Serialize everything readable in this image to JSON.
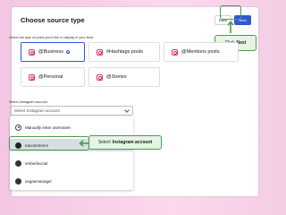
{
  "modal": {
    "title": "Choose source type",
    "back_label": "Back",
    "next_label": "Next",
    "subtitle": "Select the type of posts you'd like to display in your feed"
  },
  "source_types": [
    {
      "label": "@Business",
      "selected": true
    },
    {
      "label": "#Hashtags posts",
      "selected": false
    },
    {
      "label": "@Mentions posts",
      "selected": false
    },
    {
      "label": "@Personal",
      "selected": false
    },
    {
      "label": "@Stories",
      "selected": false
    }
  ],
  "account": {
    "label": "Select Instagram account",
    "placeholder": "Select Instagram account",
    "options": [
      {
        "label": "Manually enter username",
        "icon": "user-icon",
        "active": false
      },
      {
        "label": "eacommerce",
        "icon": "avatar",
        "active": true
      },
      {
        "label": "embedsocial",
        "icon": "avatar",
        "active": false
      },
      {
        "label": "veganmanager",
        "icon": "avatar",
        "active": false
      }
    ]
  },
  "callouts": {
    "next_prefix": "Click",
    "next_bold": "Next",
    "account_prefix": "Select",
    "account_bold": "Instagram account"
  },
  "colors": {
    "accent": "#2f57d6",
    "highlight": "#43a047",
    "instagram": "#e1306c"
  }
}
